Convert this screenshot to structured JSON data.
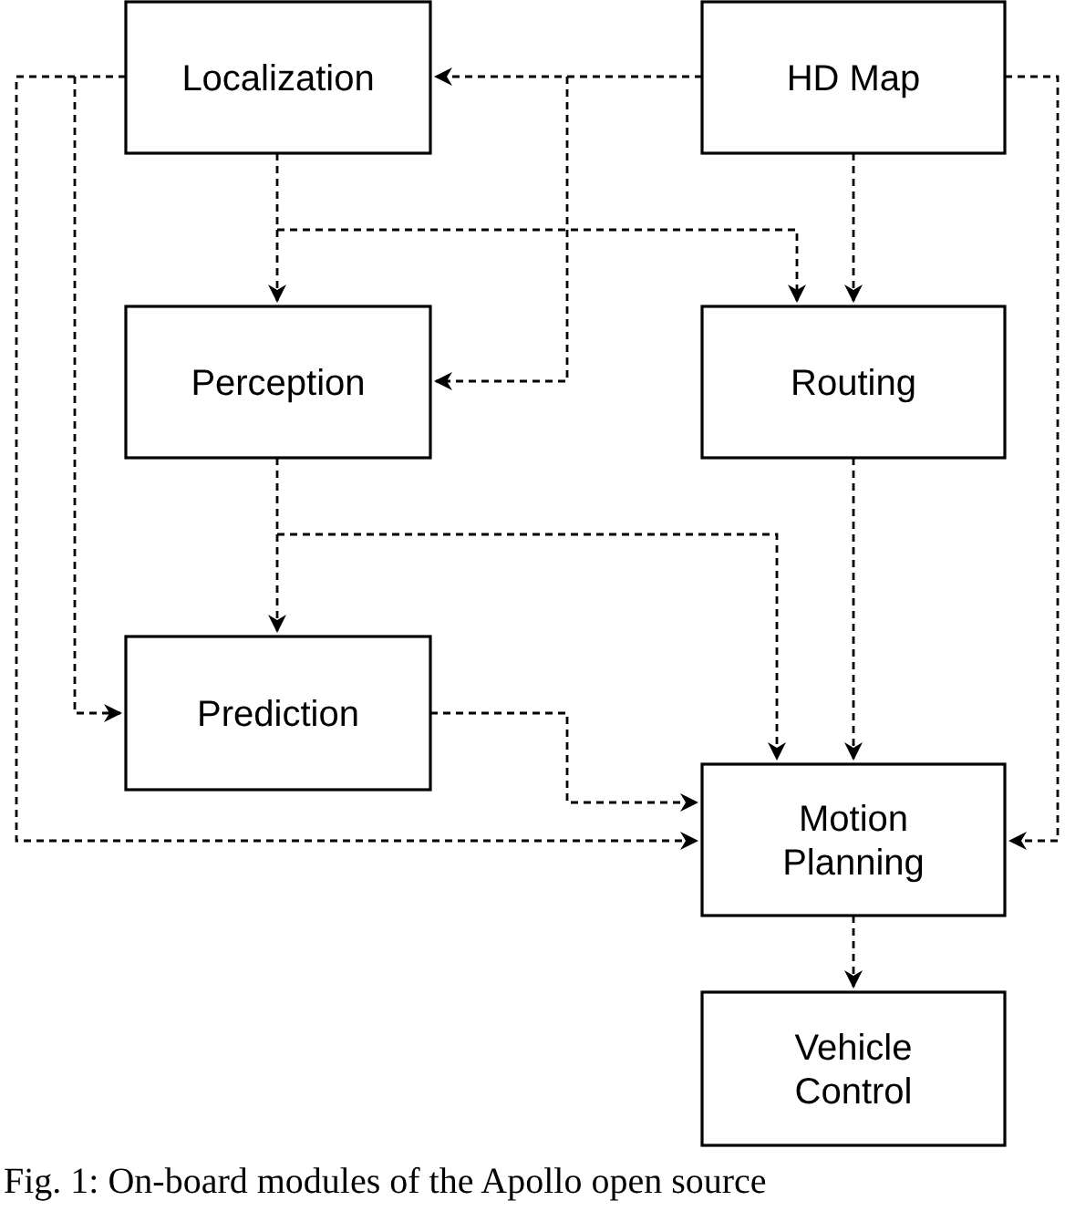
{
  "diagram": {
    "modules": [
      {
        "lines": [
          "Localization"
        ]
      },
      {
        "lines": [
          "HD Map"
        ]
      },
      {
        "lines": [
          "Perception"
        ]
      },
      {
        "lines": [
          "Routing"
        ]
      },
      {
        "lines": [
          "Prediction"
        ]
      },
      {
        "lines": [
          "Motion",
          "Planning"
        ]
      },
      {
        "lines": [
          "Vehicle",
          "Control"
        ]
      }
    ]
  },
  "caption": "Fig. 1: On-board modules of the Apollo open source"
}
